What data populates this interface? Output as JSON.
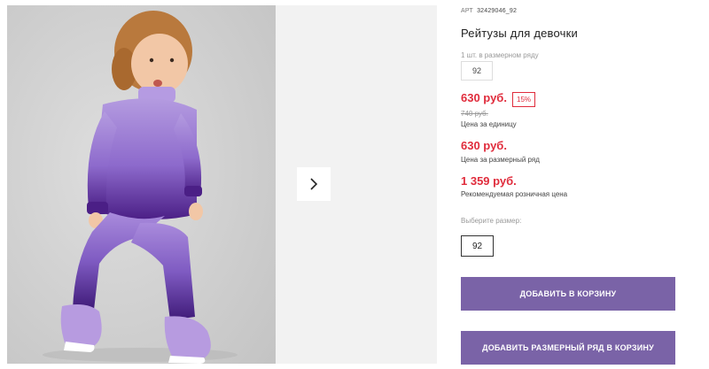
{
  "gallery": {
    "image_alt": "Ребёнок в фиолетовом костюме",
    "next_icon": "chevron-right-icon"
  },
  "product": {
    "art_label": "АРТ",
    "art_number": "32429046_92",
    "title": "Рейтузы для девочки",
    "pack_label": "1 шт. в размерном ряду",
    "pack_size": "92"
  },
  "prices": {
    "unit_price": "630 руб.",
    "discount": "15%",
    "old_price": "740 руб.",
    "unit_label": "Цена за единицу",
    "set_price": "630 руб.",
    "set_label": "Цена за размерный ряд",
    "rrp_price": "1 359 руб.",
    "rrp_label": "Рекомендуемая розничная цена"
  },
  "size": {
    "label": "Выберите размер:",
    "selected": "92"
  },
  "actions": {
    "add_to_cart": "ДОБАВИТЬ В КОРЗИНУ",
    "add_set_to_cart": "ДОБАВИТЬ РАЗМЕРНЫЙ РЯД В КОРЗИНУ"
  },
  "colors": {
    "accent": "#7a63a7",
    "price_red": "#e02c3c",
    "outfit_purple": "#8c6bc9",
    "outfit_dark": "#4b1f86"
  }
}
